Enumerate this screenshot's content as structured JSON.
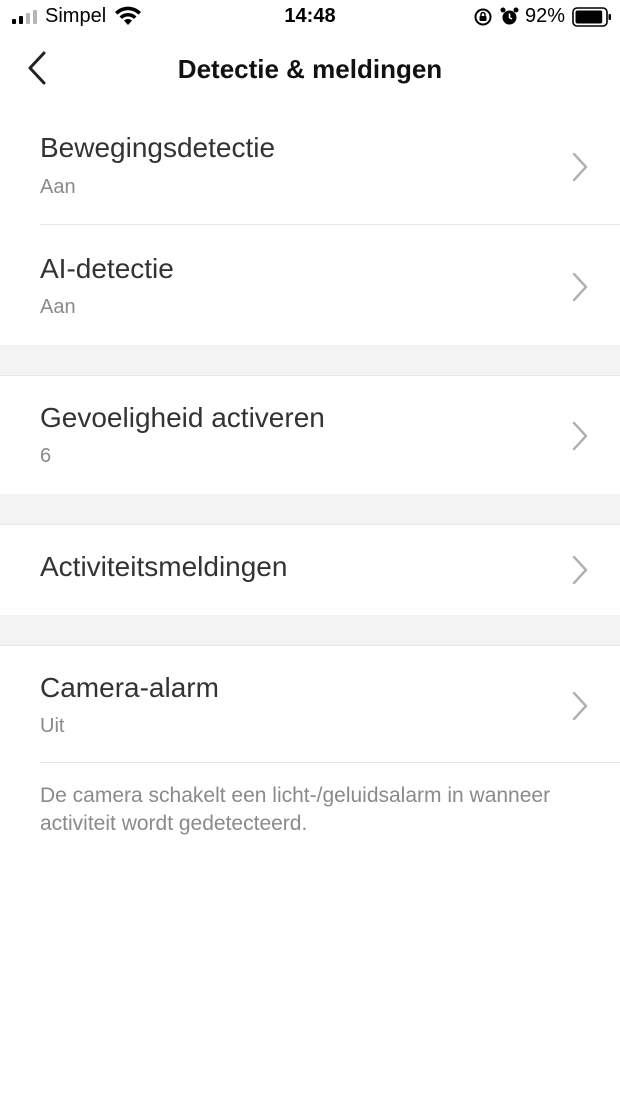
{
  "status_bar": {
    "carrier": "Simpel",
    "time": "14:48",
    "battery_percent": "92%",
    "battery_level": 0.92
  },
  "nav": {
    "title": "Detectie & meldingen"
  },
  "items": [
    {
      "title": "Bewegingsdetectie",
      "subtitle": "Aan"
    },
    {
      "title": "AI-detectie",
      "subtitle": "Aan"
    },
    {
      "title": "Gevoeligheid activeren",
      "subtitle": "6"
    },
    {
      "title": "Activiteitsmeldingen"
    },
    {
      "title": "Camera-alarm",
      "subtitle": "Uit"
    }
  ],
  "footer_note": "De camera schakelt een licht-/geluidsalarm in wanneer activiteit wordt gedetecteerd.",
  "colors": {
    "background": "#ffffff",
    "section_gap": "#f3f3f3",
    "title_text": "#333333",
    "secondary_text": "#8a8a8a"
  }
}
